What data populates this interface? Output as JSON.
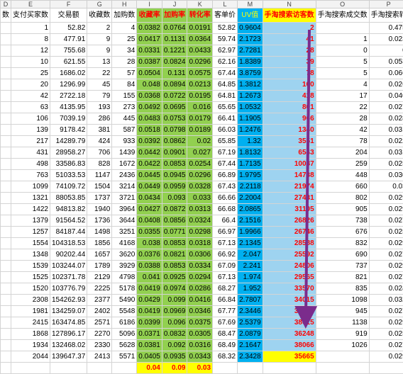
{
  "column_letters": [
    "D",
    "E",
    "F",
    "G",
    "H",
    "I",
    "J",
    "K",
    "L",
    "M",
    "N",
    "O",
    "P"
  ],
  "headers": [
    "数",
    "支付买家数",
    "交易额",
    "收藏数",
    "加购数",
    "收藏率",
    "加购率",
    "转化率",
    "客单价",
    "UV值",
    "手淘搜索访客数",
    "手淘搜索成交数",
    "手淘搜索转"
  ],
  "rows": [
    [
      "",
      "1",
      "52.82",
      "2",
      "4",
      "0.0382",
      "0.0764",
      "0.0191",
      "52.82",
      "0.9604",
      "2",
      "",
      "0.475"
    ],
    [
      "",
      "8",
      "477.91",
      "9",
      "25",
      "0.0417",
      "0.1131",
      "0.0364",
      "59.74",
      "2.1723",
      "41",
      "1",
      "0.023"
    ],
    [
      "",
      "12",
      "755.68",
      "9",
      "34",
      "0.0331",
      "0.1221",
      "0.0433",
      "62.97",
      "2.7281",
      "28",
      "0",
      "0"
    ],
    [
      "",
      "10",
      "621.55",
      "13",
      "28",
      "0.0387",
      "0.0824",
      "0.0296",
      "62.16",
      "1.8389",
      "39",
      "5",
      "0.053"
    ],
    [
      "",
      "25",
      "1686.02",
      "22",
      "57",
      "0.0504",
      "0.131",
      "0.0575",
      "67.44",
      "3.8759",
      "78",
      "5",
      "0.066"
    ],
    [
      "",
      "20",
      "1296.99",
      "45",
      "84",
      "0.048",
      "0.0894",
      "0.0213",
      "64.85",
      "1.3812",
      "160",
      "4",
      "0.026"
    ],
    [
      "",
      "42",
      "2722.18",
      "79",
      "155",
      "0.0368",
      "0.0722",
      "0.0195",
      "64.81",
      "1.2673",
      "418",
      "17",
      "0.040"
    ],
    [
      "",
      "63",
      "4135.95",
      "193",
      "273",
      "0.0492",
      "0.0695",
      "0.016",
      "65.65",
      "1.0532",
      "801",
      "22",
      "0.027"
    ],
    [
      "",
      "106",
      "7039.19",
      "286",
      "445",
      "0.0483",
      "0.0753",
      "0.0179",
      "66.41",
      "1.1905",
      "966",
      "28",
      "0.028"
    ],
    [
      "",
      "139",
      "9178.42",
      "381",
      "587",
      "0.0518",
      "0.0798",
      "0.0189",
      "66.03",
      "1.2476",
      "1340",
      "42",
      "0.031"
    ],
    [
      "",
      "217",
      "14289.79",
      "424",
      "933",
      "0.0392",
      "0.0862",
      "0.02",
      "65.85",
      "1.32",
      "3551",
      "78",
      "0.022"
    ],
    [
      "",
      "431",
      "28958.27",
      "706",
      "1439",
      "0.0442",
      "0.0901",
      "0.027",
      "67.19",
      "1.8132",
      "6543",
      "204",
      "0.031"
    ],
    [
      "",
      "498",
      "33586.83",
      "828",
      "1672",
      "0.0422",
      "0.0853",
      "0.0254",
      "67.44",
      "1.7135",
      "10087",
      "259",
      "0.025"
    ],
    [
      "",
      "763",
      "51033.53",
      "1147",
      "2436",
      "0.0445",
      "0.0945",
      "0.0296",
      "66.89",
      "1.9795",
      "14738",
      "448",
      "0.030"
    ],
    [
      "",
      "1099",
      "74109.72",
      "1504",
      "3214",
      "0.0449",
      "0.0959",
      "0.0328",
      "67.43",
      "2.2118",
      "21974",
      "660",
      "0.03"
    ],
    [
      "",
      "1321",
      "88053.85",
      "1737",
      "3721",
      "0.0434",
      "0.093",
      "0.033",
      "66.66",
      "2.2004",
      "27431",
      "802",
      "0.029"
    ],
    [
      "",
      "1422",
      "94813.82",
      "1940",
      "3964",
      "0.0427",
      "0.0872",
      "0.0313",
      "66.68",
      "2.0865",
      "31105",
      "905",
      "0.029"
    ],
    [
      "",
      "1379",
      "91564.52",
      "1736",
      "3644",
      "0.0408",
      "0.0856",
      "0.0324",
      "66.4",
      "2.1516",
      "26826",
      "738",
      "0.027"
    ],
    [
      "",
      "1257",
      "84187.44",
      "1498",
      "3251",
      "0.0355",
      "0.0771",
      "0.0298",
      "66.97",
      "1.9966",
      "26746",
      "676",
      "0.025"
    ],
    [
      "",
      "1554",
      "104318.53",
      "1856",
      "4168",
      "0.038",
      "0.0853",
      "0.0318",
      "67.13",
      "2.1345",
      "28588",
      "832",
      "0.029"
    ],
    [
      "",
      "1348",
      "90202.44",
      "1657",
      "3620",
      "0.0376",
      "0.0821",
      "0.0306",
      "66.92",
      "2.047",
      "25592",
      "690",
      "0.027"
    ],
    [
      "",
      "1539",
      "103244.07",
      "1789",
      "3929",
      "0.0388",
      "0.0853",
      "0.0334",
      "67.09",
      "2.241",
      "24806",
      "737",
      "0.029"
    ],
    [
      "",
      "1525",
      "102371.78",
      "2129",
      "4798",
      "0.041",
      "0.0925",
      "0.0294",
      "67.13",
      "1.974",
      "29565",
      "821",
      "0.027"
    ],
    [
      "",
      "1520",
      "103776.79",
      "2225",
      "5178",
      "0.0419",
      "0.0974",
      "0.0286",
      "68.27",
      "1.952",
      "33570",
      "835",
      "0.024"
    ],
    [
      "",
      "2308",
      "154262.93",
      "2377",
      "5490",
      "0.0429",
      "0.099",
      "0.0416",
      "66.84",
      "2.7807",
      "34015",
      "1098",
      "0.032"
    ],
    [
      "",
      "1981",
      "134259.07",
      "2402",
      "5548",
      "0.0419",
      "0.0969",
      "0.0346",
      "67.77",
      "2.3446",
      "33865",
      "945",
      "0.027"
    ],
    [
      "",
      "2415",
      "163474.85",
      "2571",
      "6186",
      "0.0399",
      "0.096",
      "0.0375",
      "67.69",
      "2.5379",
      "38615",
      "1138",
      "0.029"
    ],
    [
      "",
      "1868",
      "127896.17",
      "2270",
      "5096",
      "0.0371",
      "0.0832",
      "0.0305",
      "68.47",
      "2.0879",
      "36248",
      "919",
      "0.025"
    ],
    [
      "",
      "1934",
      "132468.02",
      "2330",
      "5628",
      "0.0381",
      "0.092",
      "0.0316",
      "68.49",
      "2.1647",
      "38066",
      "1026",
      "0.027"
    ],
    [
      "",
      "2044",
      "139647.37",
      "2413",
      "5571",
      "0.0405",
      "0.0935",
      "0.0343",
      "68.32",
      "2.3428",
      "35665",
      "",
      "0.029"
    ]
  ],
  "summary": [
    "0.04",
    "0.09",
    "0.03"
  ],
  "colors": {
    "green": "#92d050",
    "blue": "#00b0f0",
    "yellow": "#ffff00",
    "red": "#ff0000",
    "arrow": "#7b2c8c"
  }
}
